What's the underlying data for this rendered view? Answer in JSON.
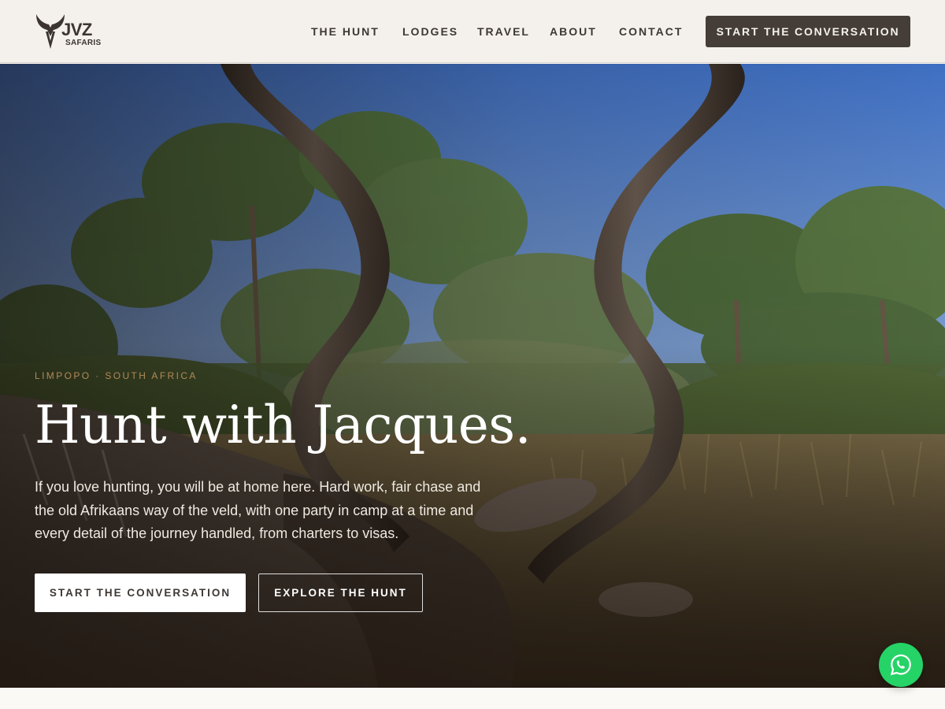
{
  "brand": {
    "logo_word": "JVZ",
    "logo_sub": "SAFARIS"
  },
  "nav": {
    "items": [
      "THE HUNT",
      "LODGES",
      "TRAVEL",
      "ABOUT",
      "CONTACT"
    ],
    "cta_label": "START THE CONVERSATION"
  },
  "hero": {
    "eyebrow": "LIMPOPO · SOUTH AFRICA",
    "title": "Hunt with Jacques.",
    "description": "If you love hunting, you will be at home here. Hard work, fair chase and the old Afrikaans way of the veld, with one party in camp at a time and every detail of the journey handled, from charters to visas.",
    "primary_button": "START THE CONVERSATION",
    "secondary_button": "EXPLORE THE HUNT"
  },
  "widgets": {
    "chat_icon": "whatsapp-icon"
  },
  "colors": {
    "header_bg": "#f4f1ec",
    "cta_bg": "#453d37",
    "eyebrow": "#b08a58",
    "whatsapp": "#25d366"
  }
}
